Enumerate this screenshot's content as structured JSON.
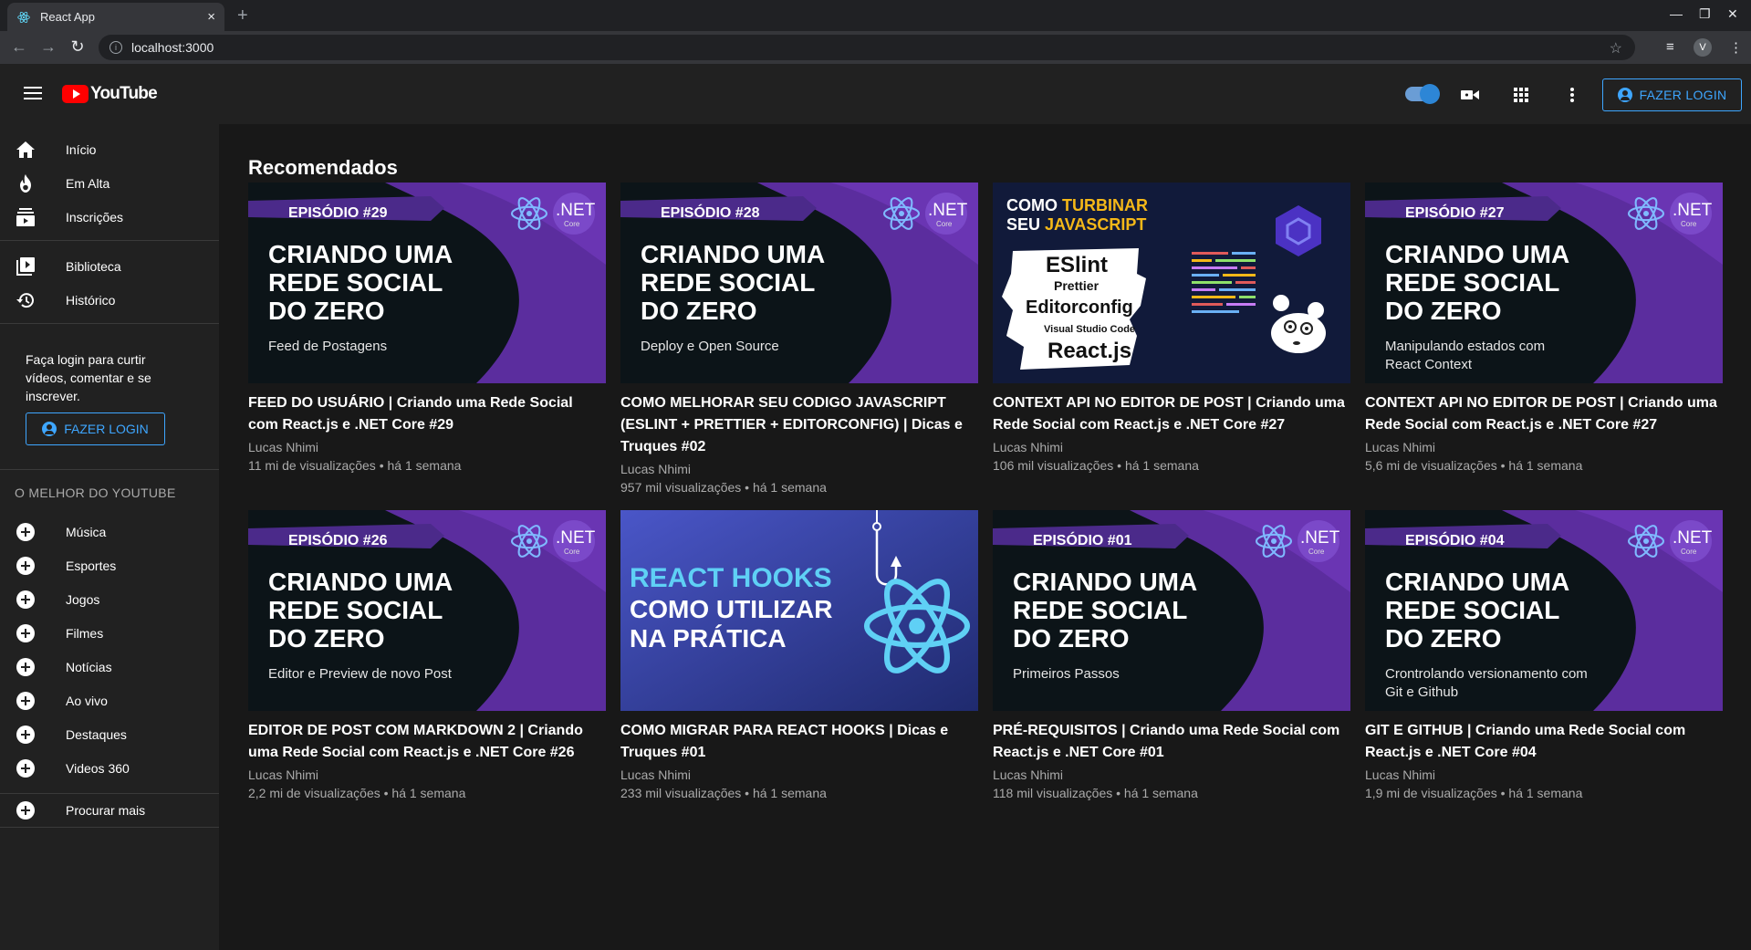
{
  "browser": {
    "tab_title": "React App",
    "tab_close": "×",
    "new_tab": "+",
    "url": "localhost:3000",
    "profile_letter": "V",
    "win_min": "—",
    "win_max": "❐",
    "win_close": "✕",
    "back": "←",
    "forward": "→",
    "reload": "↻",
    "star": "☆",
    "info": "i",
    "menu": "⋮",
    "extension": "≡"
  },
  "header": {
    "logo_text": "YouTube",
    "login_label": "FAZER LOGIN",
    "apps_icon": "apps-icon",
    "video_icon": "video-camera-icon",
    "more_icon": "more-vert-icon",
    "accent_color": "#3ea6ff"
  },
  "sidebar": {
    "main_items": [
      {
        "label": "Início",
        "icon": "home-icon"
      },
      {
        "label": "Em Alta",
        "icon": "fire-icon"
      },
      {
        "label": "Inscrições",
        "icon": "subscriptions-icon"
      }
    ],
    "library_items": [
      {
        "label": "Biblioteca",
        "icon": "library-icon"
      },
      {
        "label": "Histórico",
        "icon": "history-icon"
      }
    ],
    "login_prompt": "Faça login para curtir vídeos, comentar e se inscrever.",
    "login_label": "FAZER LOGIN",
    "section_title": "O MELHOR DO YOUTUBE",
    "best_items": [
      {
        "label": "Música"
      },
      {
        "label": "Esportes"
      },
      {
        "label": "Jogos"
      },
      {
        "label": "Filmes"
      },
      {
        "label": "Notícias"
      },
      {
        "label": "Ao vivo"
      },
      {
        "label": "Destaques"
      },
      {
        "label": "Videos 360"
      }
    ],
    "more_label": "Procurar mais"
  },
  "main": {
    "title": "Recomendados",
    "videos": [
      {
        "title": "FEED DO USUÁRIO | Criando uma Rede Social com React.js e .NET Core #29",
        "channel": "Lucas Nhimi",
        "stats": "11 mi de visualizações • há 1 semana",
        "thumb": {
          "episode": "EPISÓDIO #29",
          "line1": "CRIANDO UMA",
          "line2": "REDE SOCIAL",
          "line3": "DO ZERO",
          "sub1": "Feed de Postagens",
          "sub2": "",
          "badge": ".NET",
          "badge_sub": "Core"
        }
      },
      {
        "title": "COMO MELHORAR SEU CODIGO JAVASCRIPT (ESLINT + PRETTIER + EDITORCONFIG) | Dicas e Truques #02",
        "channel": "Lucas Nhimi",
        "stats": "957 mil visualizações • há 1 semana",
        "thumb": {
          "episode": "EPISÓDIO #28",
          "line1": "CRIANDO UMA",
          "line2": "REDE SOCIAL",
          "line3": "DO ZERO",
          "sub1": "Deploy e Open Source",
          "sub2": "",
          "badge": ".NET",
          "badge_sub": "Core"
        }
      },
      {
        "title": "CONTEXT API NO EDITOR DE POST | Criando uma Rede Social com React.js e .NET Core #27",
        "channel": "Lucas Nhimi",
        "stats": "106 mil visualizações • há 1 semana",
        "thumb_special": {
          "head1a": "COMO ",
          "head1b": "TURBINAR",
          "head2a": "SEU ",
          "head2b": "JAVASCRIPT",
          "w1": "ESlint",
          "w2": "Prettier",
          "w3": "Editorconfig",
          "w4": "Visual Studio Code",
          "w5": "React.js"
        }
      },
      {
        "title": "CONTEXT API NO EDITOR DE POST | Criando uma Rede Social com React.js e .NET Core #27",
        "channel": "Lucas Nhimi",
        "stats": "5,6 mi de visualizações • há 1 semana",
        "thumb": {
          "episode": "EPISÓDIO #27",
          "line1": "CRIANDO UMA",
          "line2": "REDE SOCIAL",
          "line3": "DO ZERO",
          "sub1": "Manipulando estados com",
          "sub2": "React Context",
          "badge": ".NET",
          "badge_sub": "Core"
        }
      },
      {
        "title": "EDITOR DE POST COM MARKDOWN 2 | Criando uma Rede Social com React.js e .NET Core #26",
        "channel": "Lucas Nhimi",
        "stats": "2,2 mi de visualizações • há 1 semana",
        "thumb": {
          "episode": "EPISÓDIO #26",
          "line1": "CRIANDO UMA",
          "line2": "REDE SOCIAL",
          "line3": "DO ZERO",
          "sub1": "Editor e Preview de novo Post",
          "sub2": "",
          "badge": ".NET",
          "badge_sub": "Core"
        }
      },
      {
        "title": "COMO MIGRAR PARA REACT HOOKS | Dicas e Truques #01",
        "channel": "Lucas Nhimi",
        "stats": "233 mil visualizações • há 1 semana",
        "thumb_hooks": {
          "l1": "REACT HOOKS",
          "l2": "COMO UTILIZAR",
          "l3": "NA PRÁTICA"
        }
      },
      {
        "title": "PRÉ-REQUISITOS | Criando uma Rede Social com React.js e .NET Core #01",
        "channel": "Lucas Nhimi",
        "stats": "118 mil visualizações • há 1 semana",
        "thumb": {
          "episode": "EPISÓDIO #01",
          "line1": "CRIANDO UMA",
          "line2": "REDE SOCIAL",
          "line3": "DO ZERO",
          "sub1": "Primeiros Passos",
          "sub2": "",
          "badge": ".NET",
          "badge_sub": "Core"
        }
      },
      {
        "title": "GIT E GITHUB | Criando uma Rede Social com React.js e .NET Core #04",
        "channel": "Lucas Nhimi",
        "stats": "1,9 mi de visualizações • há 1 semana",
        "thumb": {
          "episode": "EPISÓDIO #04",
          "line1": "CRIANDO UMA",
          "line2": "REDE SOCIAL",
          "line3": "DO ZERO",
          "sub1": "Crontrolando versionamento com",
          "sub2": "Git e Github",
          "badge": ".NET",
          "badge_sub": "Core"
        }
      }
    ]
  }
}
